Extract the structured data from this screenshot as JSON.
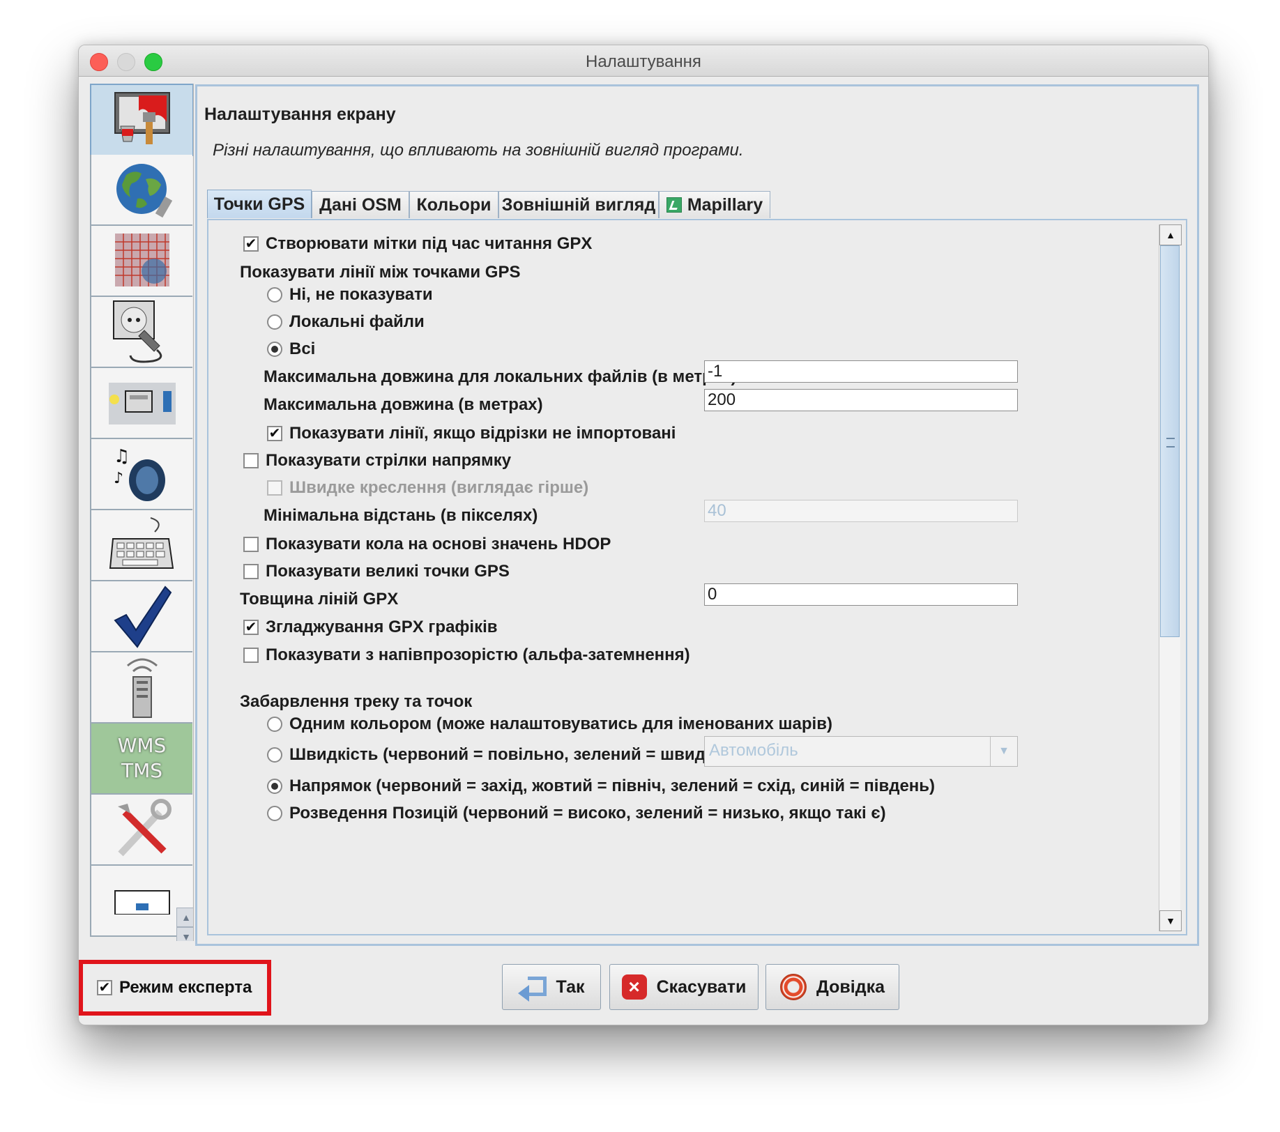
{
  "window": {
    "title": "Налаштування"
  },
  "sidebar": {
    "items": [
      {
        "icon": "display-settings-icon"
      },
      {
        "icon": "globe-icon"
      },
      {
        "icon": "projection-grid-icon"
      },
      {
        "icon": "plugin-socket-icon"
      },
      {
        "icon": "presets-folders-icon"
      },
      {
        "icon": "audio-speaker-icon"
      },
      {
        "icon": "keyboard-shortcuts-icon"
      },
      {
        "icon": "validator-checkmark-icon"
      },
      {
        "icon": "remote-control-icon"
      },
      {
        "icon": "wms-tms-icon",
        "text_line1": "WMS",
        "text_line2": "TMS"
      },
      {
        "icon": "advanced-tools-icon"
      },
      {
        "icon": "map-paint-styles-icon"
      }
    ]
  },
  "main": {
    "title": "Налаштування екрану",
    "description": "Різні налаштування, що впливають на зовнішній вигляд програми.",
    "tabs": [
      {
        "label": "Точки GPS",
        "active": true
      },
      {
        "label": "Дані OSM"
      },
      {
        "label": "Кольори"
      },
      {
        "label": "Зовнішній вигляд"
      },
      {
        "label": "Mapillary",
        "icon": "mapillary-icon"
      }
    ]
  },
  "gps": {
    "create_markers": "Створювати мітки під час читання GPX",
    "show_lines_heading": "Показувати лінії між точками GPS",
    "radio_no": "Ні, не показувати",
    "radio_local": "Локальні файли",
    "radio_all": "Всі",
    "max_len_local_label": "Максимальна довжина для локальних файлів (в метрах)",
    "max_len_local_value": "-1",
    "max_len_label": "Максимальна довжина (в метрах)",
    "max_len_value": "200",
    "show_if_not_imported": "Показувати лінії, якщо відрізки не імпортовані",
    "show_arrows": "Показувати стрілки напрямку",
    "fast_drawing": "Швидке креслення (виглядає гірше)",
    "min_distance_label": "Мінімальна відстань (в пікселях)",
    "min_distance_value": "40",
    "hdop_circles": "Показувати кола на основі значень HDOP",
    "large_points": "Показувати великі точки GPS",
    "line_width_label": "Товщина ліній GPX",
    "line_width_value": "0",
    "antialiasing": "Згладжування GPX графіків",
    "alpha_blend": "Показувати з напівпрозорістю (альфа-затемнення)",
    "coloring_heading": "Забарвлення треку та точок",
    "color_single": "Одним кольором (може налаштовуватись для іменованих шарів)",
    "color_velocity": "Швидкість (червоний = повільно, зелений = швидко)",
    "velocity_combo": "Автомобіль",
    "color_direction": "Напрямок (червоний = захід, жовтий = північ, зелений = схід, синій = південь)",
    "color_dilution": "Розведення Позицій (червоний = високо, зелений = низько, якщо такі є)"
  },
  "footer": {
    "expert_mode": "Режим експерта",
    "ok": "Так",
    "cancel": "Скасувати",
    "help": "Довідка"
  }
}
